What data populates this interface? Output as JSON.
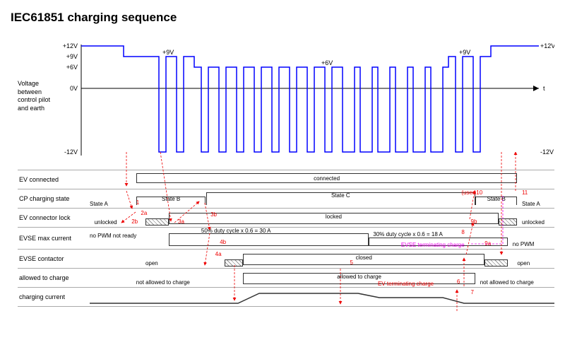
{
  "title": "IEC61851 charging sequence",
  "chart_data": {
    "type": "timing-diagram",
    "title": "Voltage between control pilot and earth",
    "ylabel": "Voltage\nbetween\ncontrol pilot\nand earth",
    "xlabel": "t",
    "y_ticks": [
      "+12V",
      "+9V",
      "+6V",
      "0V",
      "-12V"
    ],
    "right_ticks": [
      "+12V",
      "-12V"
    ],
    "segments": [
      {
        "phase": "A",
        "level": 12,
        "pwm": false
      },
      {
        "phase": "B",
        "level": 9,
        "pwm": false,
        "annotation": "+9V"
      },
      {
        "phase": "B_pwm",
        "level": 9,
        "pwm": true
      },
      {
        "phase": "C_pwm50",
        "level": 6,
        "pwm": true,
        "duty": 50,
        "annotation": "+6V"
      },
      {
        "phase": "C_pwm30",
        "level": 6,
        "pwm": true,
        "duty": 30
      },
      {
        "phase": "B_end",
        "level": 9,
        "pwm": true,
        "annotation": "+9V"
      },
      {
        "phase": "A_end",
        "level": 12,
        "pwm": false
      }
    ],
    "pwm_low": -12
  },
  "rows": {
    "ev_connected": {
      "label": "EV connected",
      "states": [
        {
          "text": "connected",
          "from": 10,
          "to": 92
        }
      ]
    },
    "cp_state": {
      "label": "CP charging state",
      "states": [
        {
          "text": "State A",
          "from": 0,
          "to": 10
        },
        {
          "text": "State B",
          "from": 10,
          "to": 25
        },
        {
          "text": "State C",
          "from": 25,
          "to": 83
        },
        {
          "text": "State B",
          "from": 83,
          "to": 92
        },
        {
          "text": "State A",
          "from": 92,
          "to": 100
        }
      ]
    },
    "ev_lock": {
      "label": "EV connector lock",
      "states": [
        {
          "text": "unlocked",
          "from": 0,
          "to": 12,
          "hatch_after": true
        },
        {
          "text": "locked",
          "from": 17,
          "to": 88,
          "hatch_after": true
        },
        {
          "text": "unlocked",
          "from": 92,
          "to": 100
        }
      ]
    },
    "evse_max_current": {
      "label": "EVSE max current",
      "states": [
        {
          "text": "no PWM\nnot ready",
          "from": 0,
          "to": 17
        },
        {
          "text": "50% duty cycle x 0.6 = 30 A",
          "from": 17,
          "to": 60,
          "label_above": true
        },
        {
          "text": "30% duty cycle x 0.6 = 18 A",
          "from": 60,
          "to": 90,
          "label_above": true
        },
        {
          "text": "no PWM",
          "from": 90,
          "to": 100
        }
      ]
    },
    "evse_contactor": {
      "label": "EVSE contactor",
      "states": [
        {
          "text": "open",
          "from": 0,
          "to": 29,
          "hatch_after": true
        },
        {
          "text": "closed",
          "from": 33,
          "to": 85,
          "hatch_after": true
        },
        {
          "text": "open",
          "from": 90,
          "to": 100
        }
      ]
    },
    "allowed": {
      "label": "allowed to charge",
      "states": [
        {
          "text": "not allowed to charge",
          "from": 0,
          "to": 33
        },
        {
          "text": "allowed to charge",
          "from": 33,
          "to": 83
        },
        {
          "text": "not allowed to charge",
          "from": 83,
          "to": 100
        }
      ]
    },
    "current": {
      "label": "charging current",
      "waveform": "ramp"
    }
  },
  "annotations": {
    "red": [
      "1",
      "2a",
      "2b",
      "3a",
      "3b",
      "4a",
      "4b",
      "5",
      "6",
      "7",
      "8",
      "9a",
      "9b",
      "(user)10",
      "11"
    ],
    "ev_terminating": "EV terminating charge",
    "evse_terminating": "EVSE terminating charge"
  }
}
